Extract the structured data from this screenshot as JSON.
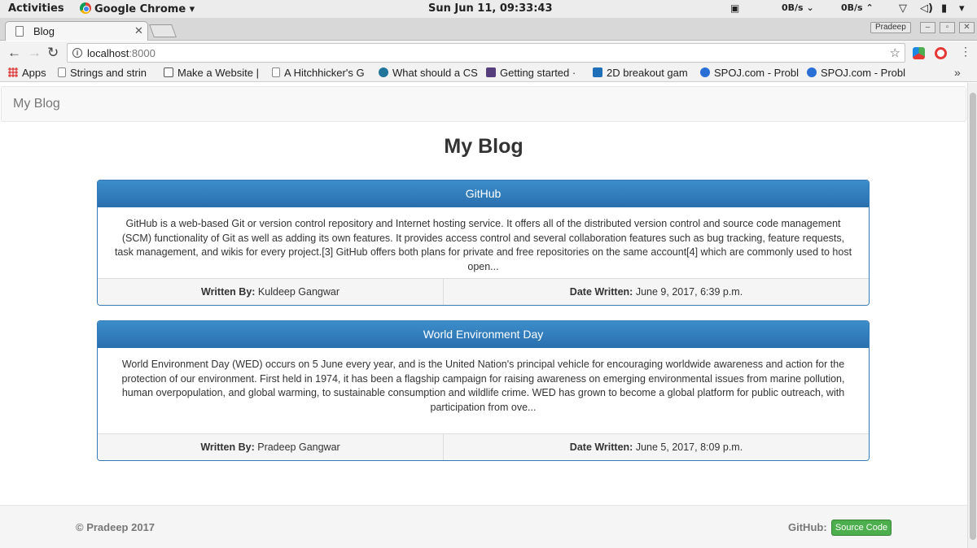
{
  "os_bar": {
    "activities": "Activities",
    "app_name": "Google Chrome",
    "clock": "Sun Jun 11, 09:33:43",
    "net_down": "0B/s",
    "net_up": "0B/s"
  },
  "browser": {
    "tab_title": "Blog",
    "profile_name": "Pradeep",
    "url_host": "localhost",
    "url_port": ":8000",
    "bookmarks": [
      {
        "label": "Apps",
        "icon_color": "#d44"
      },
      {
        "label": "Strings and strin",
        "icon_color": "#888"
      },
      {
        "label": "Make a Website |",
        "icon_color": "#555"
      },
      {
        "label": "A Hitchhicker's G",
        "icon_color": "#888"
      },
      {
        "label": "What should a CS",
        "icon_color": "#21759b"
      },
      {
        "label": "Getting started ·",
        "icon_color": "#563d7c"
      },
      {
        "label": "2D breakout gam",
        "icon_color": "#1e6fb8"
      },
      {
        "label": "SPOJ.com - Probl",
        "icon_color": "#2a6fd6"
      },
      {
        "label": "SPOJ.com - Probl",
        "icon_color": "#2a6fd6"
      }
    ]
  },
  "site": {
    "brand": "My Blog",
    "title": "My Blog",
    "posts": [
      {
        "title": "GitHub",
        "body": "GitHub is a web-based Git or version control repository and Internet hosting service. It offers all of the distributed version control and source code management (SCM) functionality of Git as well as adding its own features. It provides access control and several collaboration features such as bug tracking, feature requests, task management, and wikis for every project.[3] GitHub offers both plans for private and free repositories on the same account[4] which are commonly used to host open...",
        "author_label": "Written By:",
        "author": "Kuldeep Gangwar",
        "date_label": "Date Written:",
        "date": "June 9, 2017, 6:39 p.m."
      },
      {
        "title": "World Environment Day",
        "body": "World Environment Day (WED) occurs on 5 June every year, and is the United Nation's principal vehicle for encouraging worldwide awareness and action for the protection of our environment. First held in 1974, it has been a flagship campaign for raising awareness on emerging environmental issues from marine pollution, human overpopulation, and global warming, to sustainable consumption and wildlife crime. WED has grown to become a global platform for public outreach, with participation from ove...",
        "author_label": "Written By:",
        "author": "Pradeep Gangwar",
        "date_label": "Date Written:",
        "date": "June 5, 2017, 8:09 p.m."
      }
    ],
    "footer": {
      "copyright": "© Pradeep 2017",
      "github_label": "GitHub:",
      "source_button": "Source Code"
    }
  },
  "colors": {
    "panel_primary": "#337ab7",
    "button_success": "#5cb85c"
  }
}
